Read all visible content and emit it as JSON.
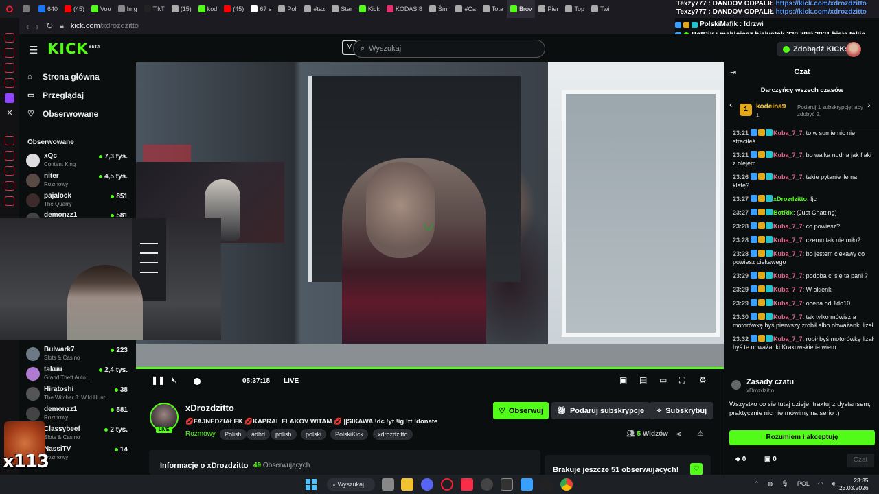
{
  "browser": {
    "tabs": [
      {
        "label": "",
        "color": "#777"
      },
      {
        "label": "640",
        "color": "#1877f2"
      },
      {
        "label": "(45)",
        "color": "#ff0000"
      },
      {
        "label": "Voo",
        "color": "#53fc18"
      },
      {
        "label": "Img",
        "color": "#888"
      },
      {
        "label": "TikT",
        "color": "#222"
      },
      {
        "label": "(15)",
        "color": "#aaa"
      },
      {
        "label": "kod",
        "color": "#53fc18"
      },
      {
        "label": "(45)",
        "color": "#ff0000"
      },
      {
        "label": "67 s",
        "color": "#fff"
      },
      {
        "label": "Poli",
        "color": "#aaa"
      },
      {
        "label": "#taz",
        "color": "#aaa"
      },
      {
        "label": "Star",
        "color": "#aaa"
      },
      {
        "label": "Kick",
        "color": "#53fc18"
      },
      {
        "label": "KODAS.8",
        "color": "#e1306c"
      },
      {
        "label": "Śmi",
        "color": "#aaa"
      },
      {
        "label": "#Ca",
        "color": "#aaa"
      },
      {
        "label": "Tota",
        "color": "#aaa"
      },
      {
        "label": "Brov",
        "color": "#53fc18"
      },
      {
        "label": "Pier",
        "color": "#aaa"
      },
      {
        "label": "Top",
        "color": "#aaa"
      },
      {
        "label": "Twi",
        "color": "#aaa"
      }
    ],
    "url_host": "kick.com",
    "url_path": "/xdrozdzitto",
    "overlay_line1_user": "Texzy777 : DANDOV ODPALIŁ",
    "overlay_line1_link": "https://kick.com/xdrozdzitto",
    "overlay_line2_user": "Texzy777 : DANDOV ODPALIŁ",
    "overlay_line2_link": "https://kick.com/xdrozdzitto",
    "overlay_line3": "PolskiMafik : !drzwi",
    "overlay_line4": "BotRix : meblojesz białystok 339,79zł 2021 białe takie"
  },
  "header": {
    "logo": "KICK",
    "logo_sup": "BETA",
    "search_placeholder": "Wyszukaj",
    "kicks_button": "Zdobądź KICKs"
  },
  "nav": {
    "home": "Strona główna",
    "browse": "Przeglądaj",
    "following": "Obserwowane",
    "followed_title": "Obserwowane"
  },
  "followed_channels": [
    {
      "name": "xQc",
      "category": "Content King",
      "viewers": "7,3 tys.",
      "color": "#ddd"
    },
    {
      "name": "niter",
      "category": "Rozmowy",
      "viewers": "4,5 tys.",
      "color": "#5a4a44"
    },
    {
      "name": "pajalock",
      "category": "The Quarry",
      "viewers": "851",
      "color": "#3d2b2b"
    },
    {
      "name": "demonzz1",
      "category": "",
      "viewers": "581",
      "color": "#444"
    },
    {
      "name": "Bulwark7",
      "category": "Slots & Casino",
      "viewers": "223",
      "color": "#6d7a86"
    },
    {
      "name": "takuu",
      "category": "Grand Theft Auto ...",
      "viewers": "2,4 tys.",
      "color": "#b07ad0"
    },
    {
      "name": "Hiratoshi",
      "category": "The Witcher 3: Wild Hunt",
      "viewers": "38",
      "color": "#555"
    },
    {
      "name": "demonzz1",
      "category": "Rozmowy",
      "viewers": "581",
      "color": "#444"
    },
    {
      "name": "Classybeef",
      "category": "Slots & Casino",
      "viewers": "2 tys.",
      "color": "#884"
    },
    {
      "name": "NassiTV",
      "category": "Rozmowy",
      "viewers": "14",
      "color": "#556"
    }
  ],
  "player": {
    "live_time": "05:37:18",
    "live_label": "LIVE"
  },
  "stream": {
    "streamer": "xDrozdzitto",
    "live_badge": "LIVE",
    "title": "💋FAJNEDZIAŁEK 💋KAPRAL FLAKOV WITAM 💋 ||SIKAWA !dc !yt !ig !tt !donate",
    "category": "Rozmowy",
    "tags": [
      "Polish",
      "adhd",
      "polish",
      "polski",
      "PolskiKick",
      "xdrozdzitto"
    ],
    "follow": "Obserwuj",
    "gift_subs": "Podaruj subskrypcje",
    "subscribe": "Subskrybuj",
    "viewers_count": "5",
    "viewers_label": "Widzów",
    "about_title": "Informacje o xDrozdzitto",
    "followers_count": "49",
    "followers_label": "Obserwujących",
    "goal_text": "Brakuje jeszcze 51 obserwujacych!"
  },
  "chat": {
    "title": "Czat",
    "top_gifters_title": "Darczyńcy wszech czasów",
    "gifter_rank": "1",
    "gifter_name": "kodeina9",
    "gifter_count": "1",
    "gifter_offer": "Podaruj 1 subskrypcję, aby zdobyć 2.",
    "messages": [
      {
        "time": "23:21",
        "user": "Kuba_7_7",
        "ucolor": "#e86a8e",
        "text": "to w sumie nic nie straciłeś"
      },
      {
        "time": "23:21",
        "user": "Kuba_7_7",
        "ucolor": "#e86a8e",
        "text": "bo walka nudna jak flaki z olejem"
      },
      {
        "time": "23:26",
        "user": "Kuba_7_7",
        "ucolor": "#e86a8e",
        "text": "takie pytanie ile na klatę?"
      },
      {
        "time": "23:27",
        "user": "xDrozdzitto",
        "ucolor": "#53fc18",
        "text": "!jc"
      },
      {
        "time": "23:27",
        "user": "BotRix",
        "ucolor": "#53fc18",
        "text": "(Just Chatting)"
      },
      {
        "time": "23:28",
        "user": "Kuba_7_7",
        "ucolor": "#e86a8e",
        "text": "co powiesz?"
      },
      {
        "time": "23:28",
        "user": "Kuba_7_7",
        "ucolor": "#e86a8e",
        "text": "czemu tak nie miło?"
      },
      {
        "time": "23:28",
        "user": "Kuba_7_7",
        "ucolor": "#e86a8e",
        "text": "bo jestem ciekawy co powiesz ciekawego"
      },
      {
        "time": "23:29",
        "user": "Kuba_7_7",
        "ucolor": "#e86a8e",
        "text": "podoba ci się ta pani ?"
      },
      {
        "time": "23:29",
        "user": "Kuba_7_7",
        "ucolor": "#e86a8e",
        "text": "W okienki"
      },
      {
        "time": "23:29",
        "user": "Kuba_7_7",
        "ucolor": "#e86a8e",
        "text": "ocena od 1do10"
      },
      {
        "time": "23:30",
        "user": "Kuba_7_7",
        "ucolor": "#e86a8e",
        "text": "tak tylko mówisz a motorówkę byś pierwszy zrobił albo obważanki lizał"
      },
      {
        "time": "23:32",
        "user": "Kuba_7_7",
        "ucolor": "#e86a8e",
        "text": "robił byś motorówkę lizał byś te obważanki Krakowskie ia wiem"
      }
    ],
    "rules_title": "Zasady czatu",
    "rules_sub": "xDrozdzitto",
    "rules_text": "Wszystko co sie tutaj dzieje, traktuj z dystansem, praktycznie nic nie mówimy na serio :)",
    "rules_accept": "Rozumiem i akceptuję",
    "kicks_count": "0",
    "gift_count": "0",
    "send": "Czat"
  },
  "overlay": {
    "x113": "x113"
  },
  "taskbar": {
    "search": "Wyszukaj",
    "lang": "POL",
    "time": "23:35",
    "date": "23.03.2026"
  }
}
